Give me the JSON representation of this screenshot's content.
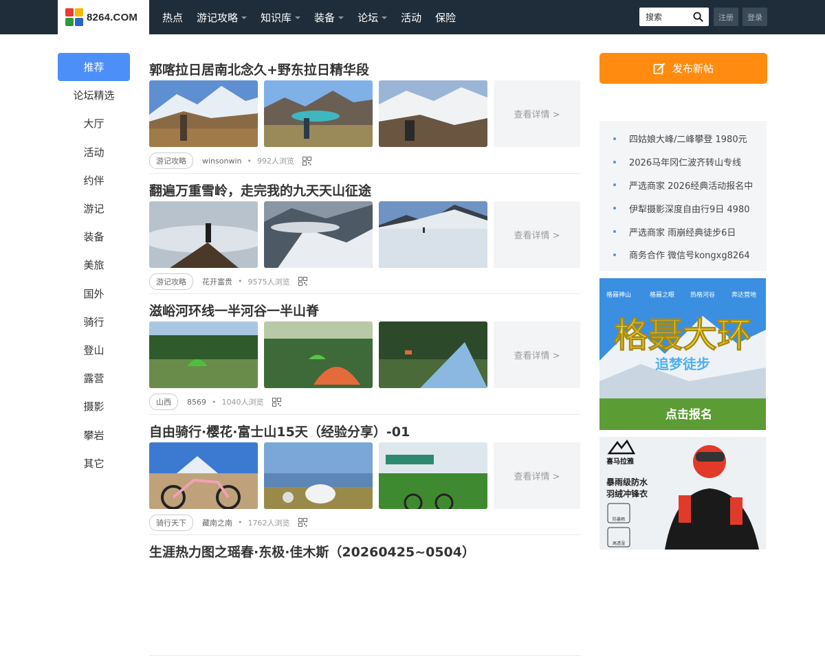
{
  "header": {
    "logo_text": "8264.COM",
    "nav": [
      {
        "label": "热点",
        "dropdown": false
      },
      {
        "label": "游记攻略",
        "dropdown": true
      },
      {
        "label": "知识库",
        "dropdown": true
      },
      {
        "label": "装备",
        "dropdown": true
      },
      {
        "label": "论坛",
        "dropdown": true
      },
      {
        "label": "活动",
        "dropdown": false
      },
      {
        "label": "保险",
        "dropdown": false
      }
    ],
    "search_placeholder": "搜索",
    "register_label": "注册",
    "login_label": "登录"
  },
  "sidebar": {
    "items": [
      "推荐",
      "论坛精选",
      "大厅",
      "活动",
      "约伴",
      "游记",
      "装备",
      "美旅",
      "国外",
      "骑行",
      "登山",
      "露营",
      "摄影",
      "攀岩",
      "其它"
    ],
    "active_index": 0
  },
  "feed": {
    "more_label": "查看详情 >",
    "posts": [
      {
        "title": "郭喀拉日居南北念久+野东拉日精华段",
        "tag": "游记攻略",
        "author": "winsonwin",
        "views": "992人浏览"
      },
      {
        "title": "翻遍万重雪岭，走完我的九天天山征途",
        "tag": "游记攻略",
        "author": "花开富贵",
        "views": "9575人浏览"
      },
      {
        "title": "滋峪河环线一半河谷一半山脊",
        "tag": "山西",
        "author": "8569",
        "views": "1040人浏览"
      },
      {
        "title": "自由骑行·樱花·富士山15天（经验分享）-01",
        "tag": "骑行天下",
        "author": "藏南之南",
        "views": "1762人浏览"
      },
      {
        "title": "生涯热力图之瑶春·东极·佳木斯（20260425~0504）",
        "tag": "",
        "author": "",
        "views": ""
      }
    ]
  },
  "right": {
    "publish_label": "发布新帖",
    "links": [
      "四姑娘大峰/二峰攀登 1980元",
      "2026马年冈仁波齐转山专线",
      "严选商家 2026经典活动报名中",
      "伊犁摄影深度自由行9日 4980",
      "严选商家 雨崩经典徒步6日",
      "商务合作 微信号kongxg8264"
    ],
    "ad1": {
      "top_labels": [
        "格聂神山",
        "格聂之眼",
        "热格河谷",
        "奔达营地"
      ],
      "headline": "格聂大环",
      "sub": "追梦徒步",
      "cta": "点击报名"
    },
    "ad2": {
      "brand": "喜马拉雅",
      "line1": "暴雨级防水",
      "line2": "羽绒冲锋衣",
      "badge1": "防暴雨",
      "badge2": "高透湿"
    }
  },
  "colors": {
    "nav_bg": "#1f2d3a",
    "active_blue": "#4d8ff8",
    "publish_orange": "#ff8c10"
  }
}
